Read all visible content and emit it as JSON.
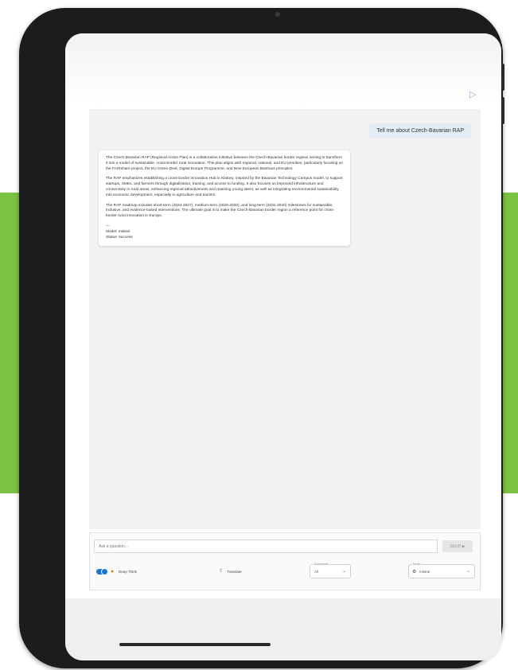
{
  "chat": {
    "user_message": "Tell me about Czech-Bavarian RAP",
    "assistant_paragraphs": [
      "The Czech-Bavarian RAP (Regional Action Plan) is a collaborative initiative between the Czech-Bavarian border regions aiming to transform it into a model of sustainable, cross-border rural innovation. This plan aligns with regional, national, and EU priorities, particularly focusing on the FAIRshare project, the EU Green Deal, Digital Europe Programme, and New European Bauhaus principles.",
      "The RAP emphasizes establishing a cross-border innovation Hub in Klatovy, inspired by the Bavarian Technology Campus model, to support startups, SMEs, and farmers through digitalization, training, and access to funding. It also focuses on improved infrastructure and connectivity in rural areas, enhancing regional attractiveness and retaining young talent, as well as integrating environmental sustainability into economic development, especially in agriculture and tourism.",
      "The RAP roadmap includes short-term (2024-2027), medium-term (2028-2030), and long-term (2031-2040) milestones for sustainable, inclusive, and evidence-based interventions. The ultimate goal is to make the Czech-Bavarian border region a reference point for cross-border rural innovation in Europe."
    ],
    "separator": "---",
    "model_line": "Model: mistral",
    "status_line": "Status: success"
  },
  "input": {
    "placeholder": "Ask a question...",
    "send_label": "SEND ▶"
  },
  "controls": {
    "deep_think_label": "Deep Think",
    "upload_label": "Translate",
    "field1_caption": "Documents",
    "field1_value": "All",
    "field2_caption": "Model",
    "field2_value": "mistral"
  },
  "colors": {
    "accent": "#1976d2",
    "brand_green": "#7cc242"
  }
}
